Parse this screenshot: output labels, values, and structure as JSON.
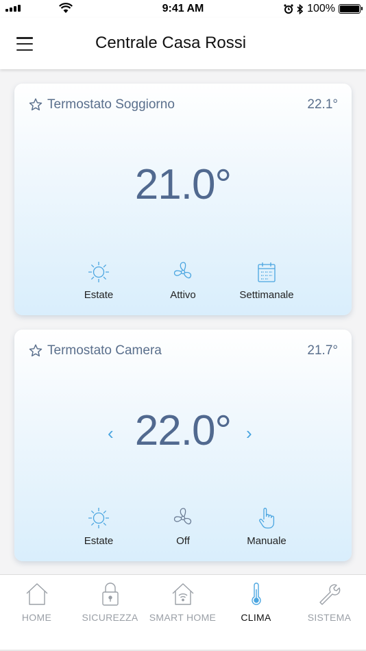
{
  "status_bar": {
    "time": "9:41 AM",
    "battery": "100%"
  },
  "header": {
    "title": "Centrale Casa Rossi",
    "menu_icon": "hamburger-icon"
  },
  "thermostats": [
    {
      "name": "Termostato Soggiorno",
      "current_temp": "22.1°",
      "setpoint": "21.0°",
      "modes": [
        {
          "label": "Estate",
          "icon": "sun-icon"
        },
        {
          "label": "Attivo",
          "icon": "fan-icon"
        },
        {
          "label": "Settimanale",
          "icon": "calendar-icon"
        }
      ]
    },
    {
      "name": "Termostato Camera",
      "current_temp": "21.7°",
      "setpoint": "22.0°",
      "decrease_glyph": "‹",
      "increase_glyph": "›",
      "modes": [
        {
          "label": "Estate",
          "icon": "sun-icon"
        },
        {
          "label": "Off",
          "icon": "fan-icon"
        },
        {
          "label": "Manuale",
          "icon": "hand-pointer-icon"
        }
      ]
    }
  ],
  "tabs": [
    {
      "label": "HOME",
      "icon": "house-icon",
      "active": false
    },
    {
      "label": "SICUREZZA",
      "icon": "lock-icon",
      "active": false
    },
    {
      "label": "SMART HOME",
      "icon": "smart-home-icon",
      "active": false
    },
    {
      "label": "CLIMA",
      "icon": "thermometer-icon",
      "active": true
    },
    {
      "label": "SISTEMA",
      "icon": "wrench-icon",
      "active": false
    }
  ],
  "colors": {
    "accent": "#4aa5e0",
    "text": "#5a6f8c",
    "card_gradient_end": "#d9eefc"
  }
}
